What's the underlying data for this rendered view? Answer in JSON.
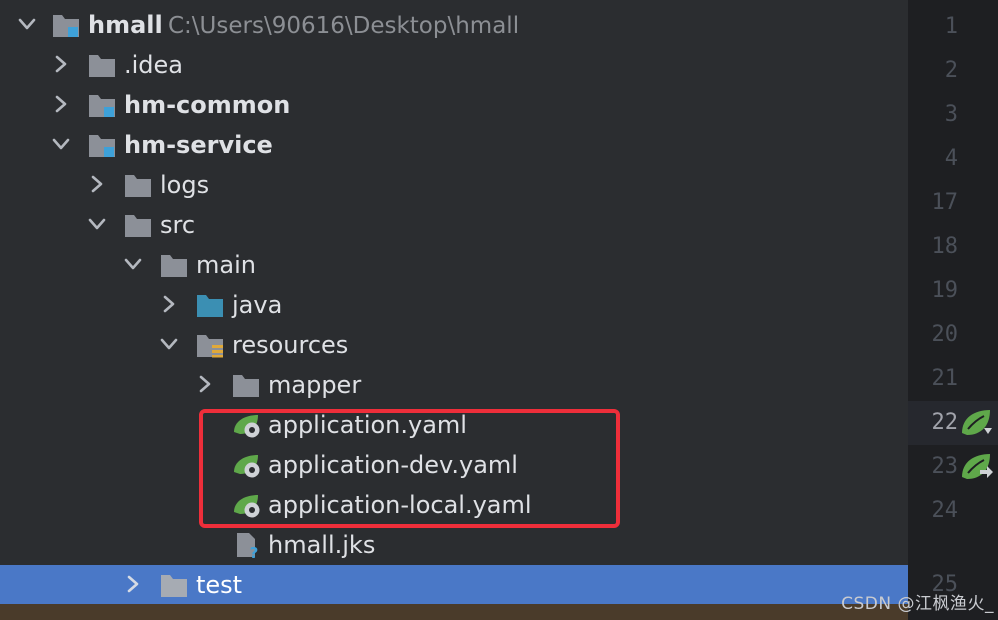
{
  "project_tree": {
    "root": {
      "name": "hmall",
      "path": "C:\\Users\\90616\\Desktop\\hmall"
    },
    "items": [
      {
        "label": ".idea",
        "icon": "folder-icon",
        "expanded": false
      },
      {
        "label": "hm-common",
        "icon": "module-folder-icon",
        "expanded": false
      },
      {
        "label": "hm-service",
        "icon": "module-folder-icon",
        "expanded": true
      },
      {
        "label": "logs",
        "icon": "folder-icon",
        "expanded": false
      },
      {
        "label": "src",
        "icon": "folder-icon",
        "expanded": true
      },
      {
        "label": "main",
        "icon": "folder-icon",
        "expanded": true
      },
      {
        "label": "java",
        "icon": "source-folder-icon",
        "expanded": false
      },
      {
        "label": "resources",
        "icon": "resources-folder-icon",
        "expanded": true
      },
      {
        "label": "mapper",
        "icon": "folder-icon",
        "expanded": false
      },
      {
        "label": "application.yaml",
        "icon": "spring-config-icon"
      },
      {
        "label": "application-dev.yaml",
        "icon": "spring-config-icon"
      },
      {
        "label": "application-local.yaml",
        "icon": "spring-config-icon"
      },
      {
        "label": "hmall.jks",
        "icon": "unknown-file-icon"
      },
      {
        "label": "test",
        "icon": "folder-icon",
        "expanded": false,
        "selected": true
      }
    ]
  },
  "gutter": {
    "line_numbers": [
      "1",
      "2",
      "3",
      "4",
      "17",
      "18",
      "19",
      "20",
      "21",
      "22",
      "23",
      "24",
      "25"
    ],
    "current_line": "22",
    "markers": [
      {
        "line": "22",
        "icon": "spring-bean-gutter-icon"
      },
      {
        "line": "23",
        "icon": "spring-navigate-gutter-icon"
      }
    ]
  },
  "watermark": "CSDN @江枫渔火_",
  "colors": {
    "tree_background": "#2b2d30",
    "editor_gutter_background": "#1e1f22",
    "selection": "#4a78c7",
    "annotation_box": "#ee2e3a",
    "folder": "#8c9098",
    "module_badge": "#3ea1d9",
    "source_folder": "#3b8fb3",
    "spring_green": "#5fa84a"
  }
}
